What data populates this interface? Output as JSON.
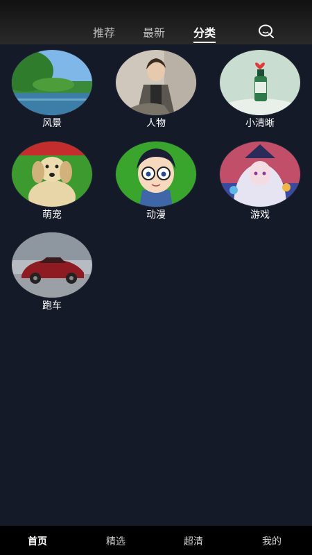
{
  "header": {
    "tabs": [
      {
        "label": "推荐",
        "active": false
      },
      {
        "label": "最新",
        "active": false
      },
      {
        "label": "分类",
        "active": true
      }
    ],
    "search_icon": "search-icon"
  },
  "categories": [
    {
      "label": "风景",
      "image": "landscape"
    },
    {
      "label": "人物",
      "image": "person"
    },
    {
      "label": "小清晰",
      "image": "fresh"
    },
    {
      "label": "萌宠",
      "image": "pet"
    },
    {
      "label": "动漫",
      "image": "anime"
    },
    {
      "label": "游戏",
      "image": "game"
    },
    {
      "label": "跑车",
      "image": "sports-car"
    }
  ],
  "bottom_nav": [
    {
      "label": "首页",
      "active": true
    },
    {
      "label": "精选",
      "active": false
    },
    {
      "label": "超清",
      "active": false
    },
    {
      "label": "我的",
      "active": false
    }
  ],
  "colors": {
    "background": "#151a28",
    "bottom_bar": "#000000",
    "accent": "#ffffff"
  }
}
